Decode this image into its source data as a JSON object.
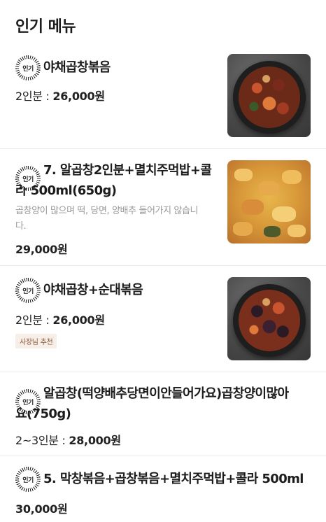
{
  "section": {
    "title": "인기 메뉴"
  },
  "badge_label": "인기",
  "items": [
    {
      "title_lines": [
        "야채곱창볶음"
      ],
      "price_prefix": "2인분 : ",
      "price": "26,000원",
      "image_icon": "food-photo"
    },
    {
      "title_lines": [
        "7. 알곱창2인분+멸치주먹밥+콜",
        "라 500ml(650g)"
      ],
      "description_lines": [
        "곱창양이 많으며 떡, 당면, 양배추 들어가지 않습니",
        "다."
      ],
      "price": "29,000원",
      "image_icon": "food-photo"
    },
    {
      "title_lines": [
        "야채곱창+순대볶음"
      ],
      "price_prefix": "2인분 : ",
      "price": "26,000원",
      "tag": "사장님 추천",
      "image_icon": "food-photo"
    },
    {
      "title_lines": [
        "알곱창(떡양배추당면이안들어가요)곱창양이많아",
        "요(750g)"
      ],
      "price_prefix": "2~3인분 : ",
      "price": "28,000원"
    },
    {
      "title_lines": [
        "5. 막창볶음+곱창볶음+멸치주먹밥+콜라 500ml"
      ],
      "price": "30,000원"
    }
  ]
}
